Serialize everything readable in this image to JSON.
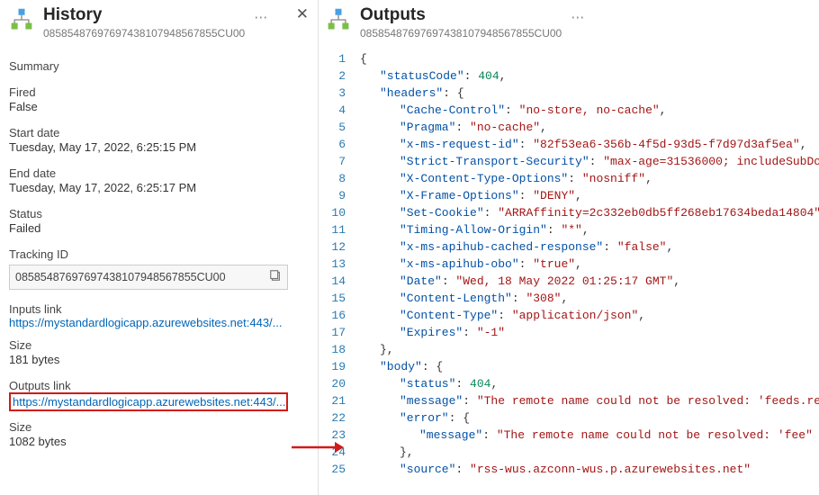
{
  "left": {
    "title": "History",
    "sub": "08585487697697438107948567855CU00",
    "summary_label": "Summary",
    "fired_label": "Fired",
    "fired_value": "False",
    "start_label": "Start date",
    "start_value": "Tuesday, May 17, 2022, 6:25:15 PM",
    "end_label": "End date",
    "end_value": "Tuesday, May 17, 2022, 6:25:17 PM",
    "status_label": "Status",
    "status_value": "Failed",
    "tracking_label": "Tracking ID",
    "tracking_value": "08585487697697438107948567855CU00",
    "inputs_link_label": "Inputs link",
    "inputs_link_value": "https://mystandardlogicapp.azurewebsites.net:443/...",
    "inputs_size_label": "Size",
    "inputs_size_value": "181 bytes",
    "outputs_link_label": "Outputs link",
    "outputs_link_value": "https://mystandardlogicapp.azurewebsites.net:443/...",
    "outputs_size_label": "Size",
    "outputs_size_value": "1082 bytes"
  },
  "right": {
    "title": "Outputs",
    "sub": "08585487697697438107948567855CU00"
  },
  "code": {
    "statusCode": 404,
    "headers": {
      "Cache-Control": "no-store, no-cache",
      "Pragma": "no-cache",
      "x-ms-request-id": "82f53ea6-356b-4f5d-93d5-f7d97d3af5ea",
      "Strict-Transport-Security": "max-age=31536000; includeSubDo",
      "X-Content-Type-Options": "nosniff",
      "X-Frame-Options": "DENY",
      "Set-Cookie": "ARRAffinity=2c332eb0db5ff268eb17634beda14804",
      "Timing-Allow-Origin": "*",
      "x-ms-apihub-cached-response": "false",
      "x-ms-apihub-obo": "true",
      "Date": "Wed, 18 May 2022 01:25:17 GMT",
      "Content-Length": "308",
      "Content-Type": "application/json",
      "Expires": "-1"
    },
    "body": {
      "status": 404,
      "message": "The remote name could not be resolved: 'feeds.re",
      "error": {
        "message": "The remote name could not be resolved: 'fee"
      },
      "source": "rss-wus.azconn-wus.p.azurewebsites.net"
    }
  }
}
